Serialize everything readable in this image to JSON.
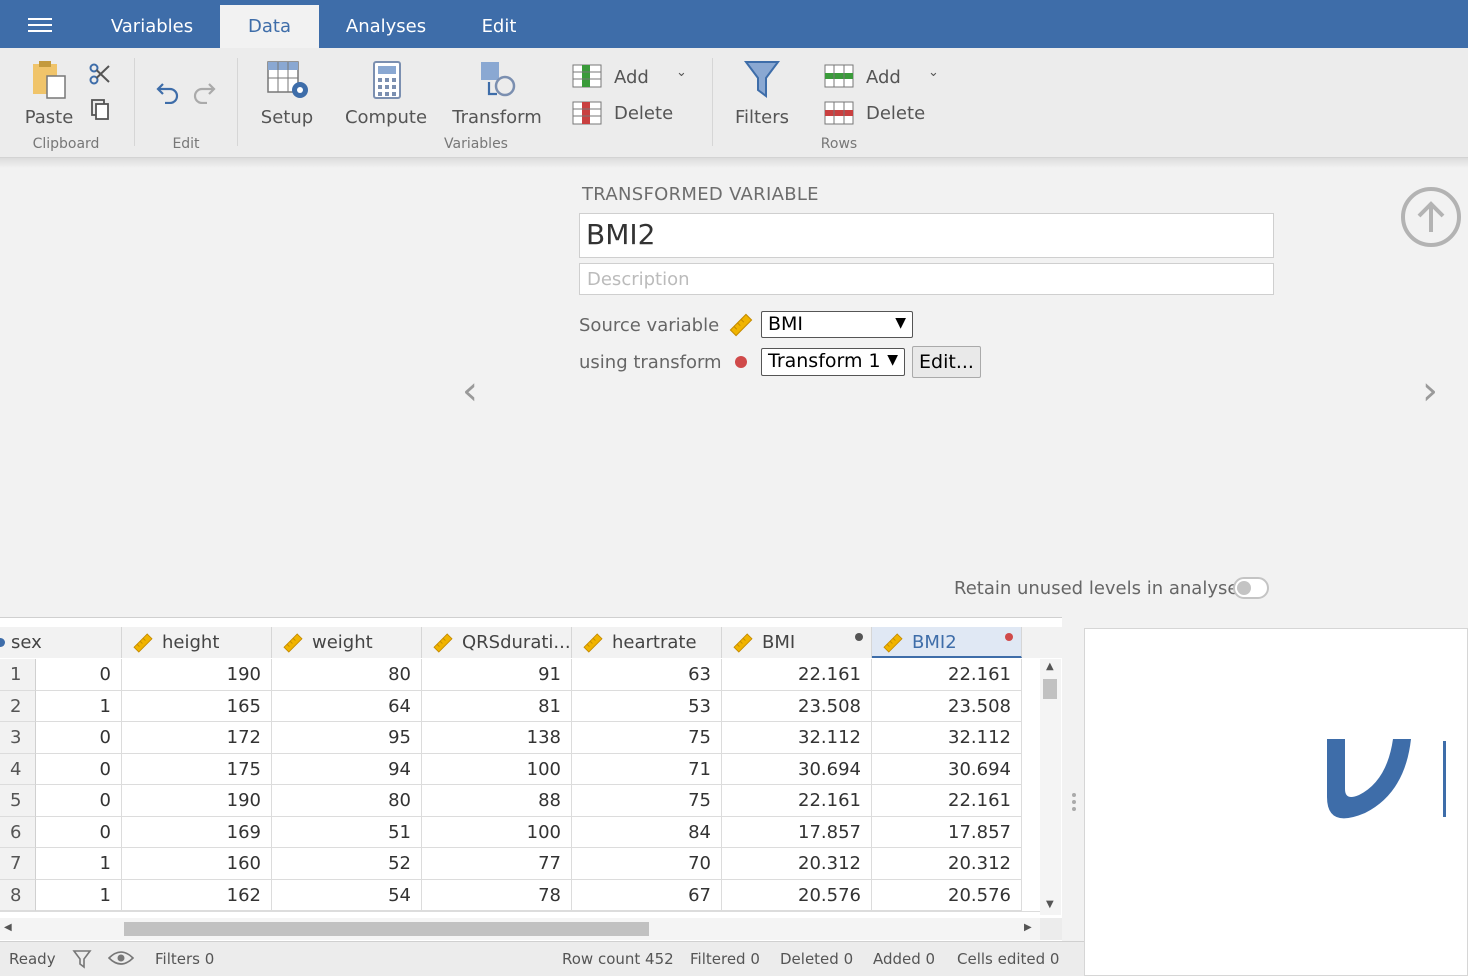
{
  "topbar": {
    "tabs": [
      {
        "label": "Variables"
      },
      {
        "label": "Data"
      },
      {
        "label": "Analyses"
      },
      {
        "label": "Edit"
      }
    ]
  },
  "ribbon": {
    "paste": "Paste",
    "clipboard_group": "Clipboard",
    "edit_group": "Edit",
    "setup": "Setup",
    "compute": "Compute",
    "transform": "Transform",
    "variables_group": "Variables",
    "var_add": "Add",
    "var_delete": "Delete",
    "filters": "Filters",
    "row_add": "Add",
    "row_delete": "Delete",
    "rows_group": "Rows"
  },
  "setup": {
    "title": "TRANSFORMED VARIABLE",
    "name": "BMI2",
    "description_placeholder": "Description",
    "source_label": "Source variable",
    "source_value": "BMI",
    "transform_label": "using transform",
    "transform_value": "Transform 1",
    "edit_button": "Edit...",
    "retain_label": "Retain unused levels in analyses",
    "retain_on": false
  },
  "grid": {
    "columns": [
      {
        "name": "sex",
        "type": "nominal"
      },
      {
        "name": "height",
        "type": "continuous"
      },
      {
        "name": "weight",
        "type": "continuous"
      },
      {
        "name": "QRSdurati...",
        "type": "continuous"
      },
      {
        "name": "heartrate",
        "type": "continuous"
      },
      {
        "name": "BMI",
        "type": "continuous",
        "dot": "#555555"
      },
      {
        "name": "BMI2",
        "type": "continuous",
        "dot": "#d04a4a",
        "selected": true
      }
    ],
    "row_numbers": [
      "1",
      "2",
      "3",
      "4",
      "5",
      "6",
      "7",
      "8"
    ],
    "rows": [
      [
        "0",
        "190",
        "80",
        "91",
        "63",
        "22.161",
        "22.161"
      ],
      [
        "1",
        "165",
        "64",
        "81",
        "53",
        "23.508",
        "23.508"
      ],
      [
        "0",
        "172",
        "95",
        "138",
        "75",
        "32.112",
        "32.112"
      ],
      [
        "0",
        "175",
        "94",
        "100",
        "71",
        "30.694",
        "30.694"
      ],
      [
        "0",
        "190",
        "80",
        "88",
        "75",
        "22.161",
        "22.161"
      ],
      [
        "0",
        "169",
        "51",
        "100",
        "84",
        "17.857",
        "17.857"
      ],
      [
        "1",
        "160",
        "52",
        "77",
        "70",
        "20.312",
        "20.312"
      ],
      [
        "1",
        "162",
        "54",
        "78",
        "67",
        "20.576",
        "20.576"
      ]
    ]
  },
  "status": {
    "ready": "Ready",
    "filters": "Filters 0",
    "row_count": "Row count 452",
    "filtered": "Filtered 0",
    "deleted": "Deleted 0",
    "added": "Added 0",
    "cells_edited": "Cells edited 0"
  },
  "colors": {
    "brand": "#3e6da9",
    "ruler": "#f0b400",
    "transform_dot": "#d04a4a"
  }
}
